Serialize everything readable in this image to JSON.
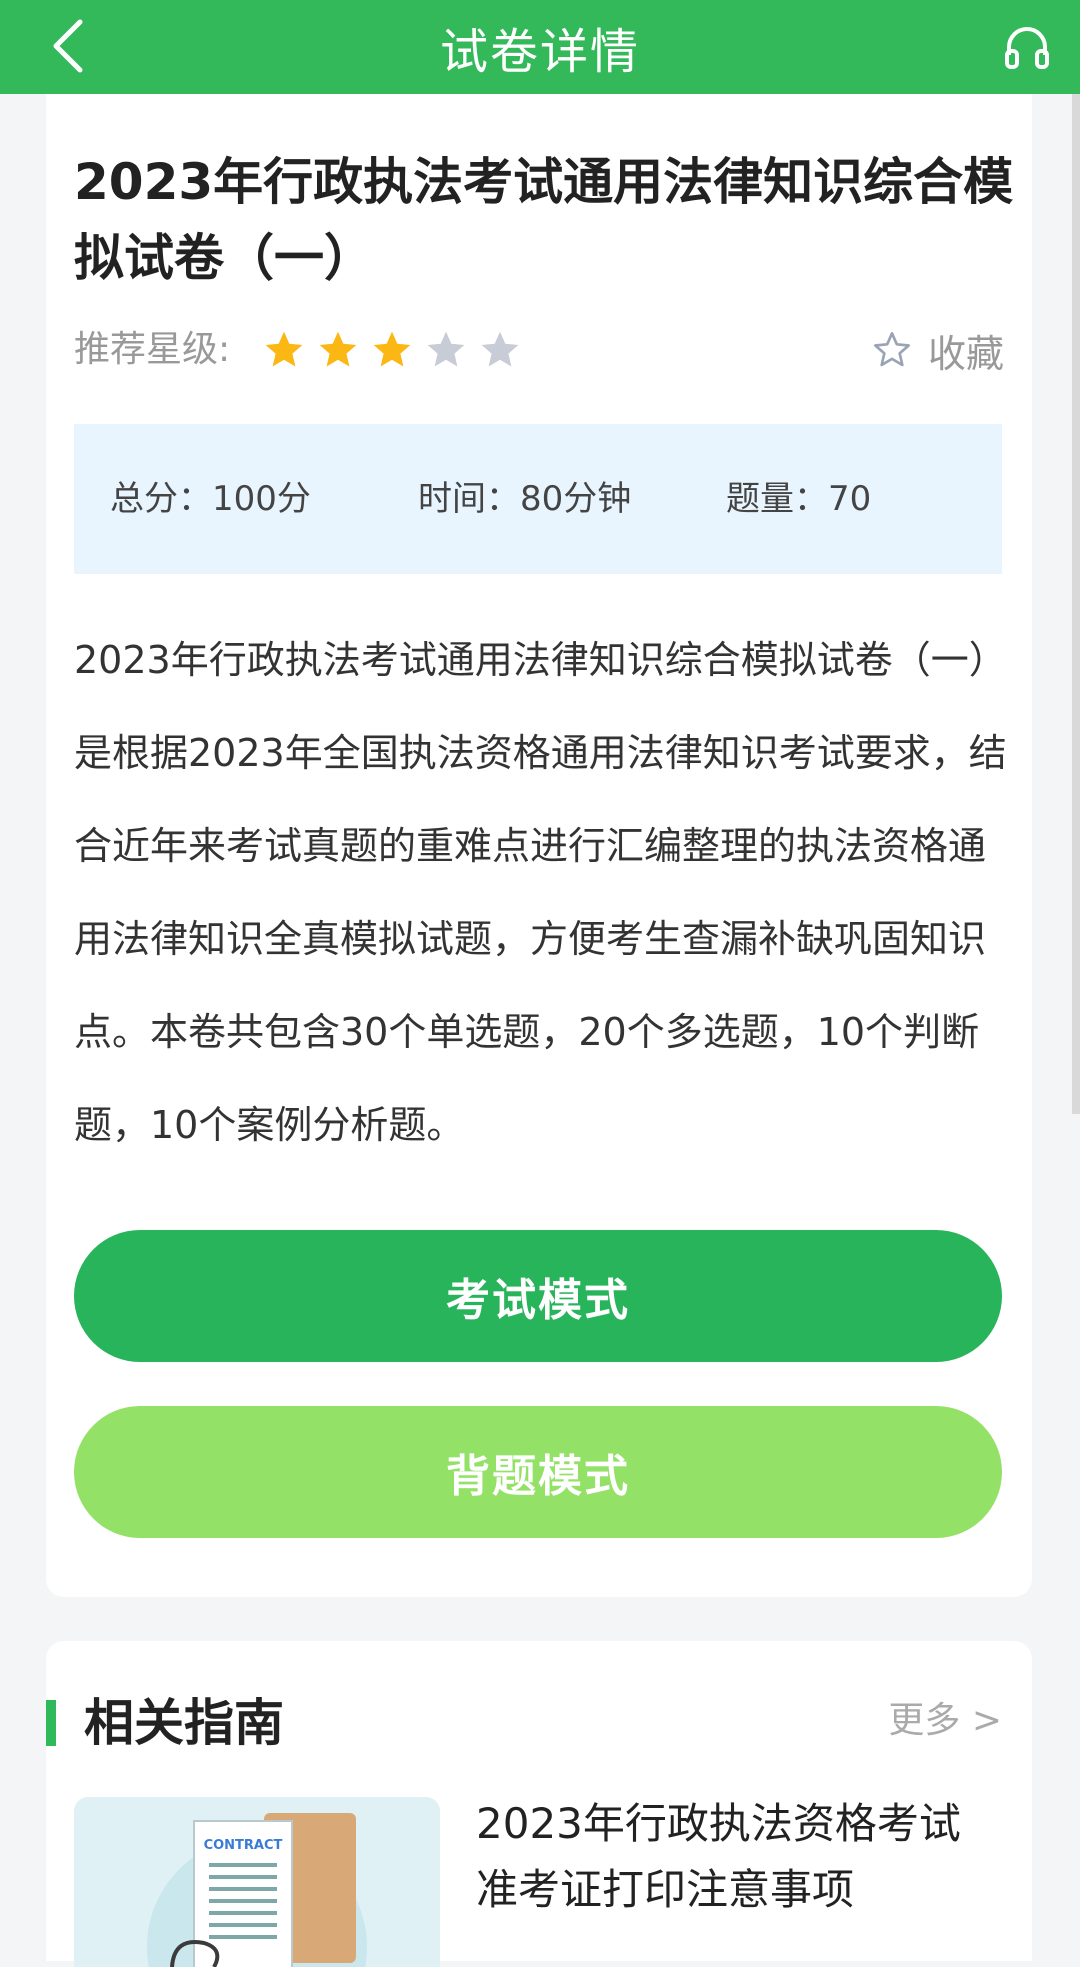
{
  "header": {
    "title": "试卷详情",
    "back_icon": "chevron-left-icon",
    "right_icon": "headset-icon"
  },
  "paper": {
    "title": "2023年行政执法考试通用法律知识综合模拟试卷（一）",
    "rating_label": "推荐星级:",
    "rating": 3,
    "rating_max": 5,
    "favorite_label": "收藏",
    "info": {
      "total_score": "总分：100分",
      "time": "时间：80分钟",
      "count": "题量：70"
    },
    "description": "2023年行政执法考试通用法律知识综合模拟试卷（一）是根据2023年全国执法资格通用法律知识考试要求，结合近年来考试真题的重难点进行汇编整理的执法资格通用法律知识全真模拟试题，方便考生查漏补缺巩固知识点。本卷共包含30个单选题，20个多选题，10个判断题，10个案例分析题。",
    "exam_mode_label": "考试模式",
    "recite_mode_label": "背题模式"
  },
  "related": {
    "title": "相关指南",
    "more_label": "更多 >",
    "items": [
      {
        "title": "2023年行政执法资格考试准考证打印注意事项",
        "thumb_text": "CONTRACT"
      }
    ]
  },
  "colors": {
    "primary": "#34b95a",
    "exam_button": "#28b45a",
    "recite_button": "#94e167",
    "info_bg": "#e8f4fe",
    "star_on": "#fbb713",
    "star_off": "#c7ccd6"
  }
}
